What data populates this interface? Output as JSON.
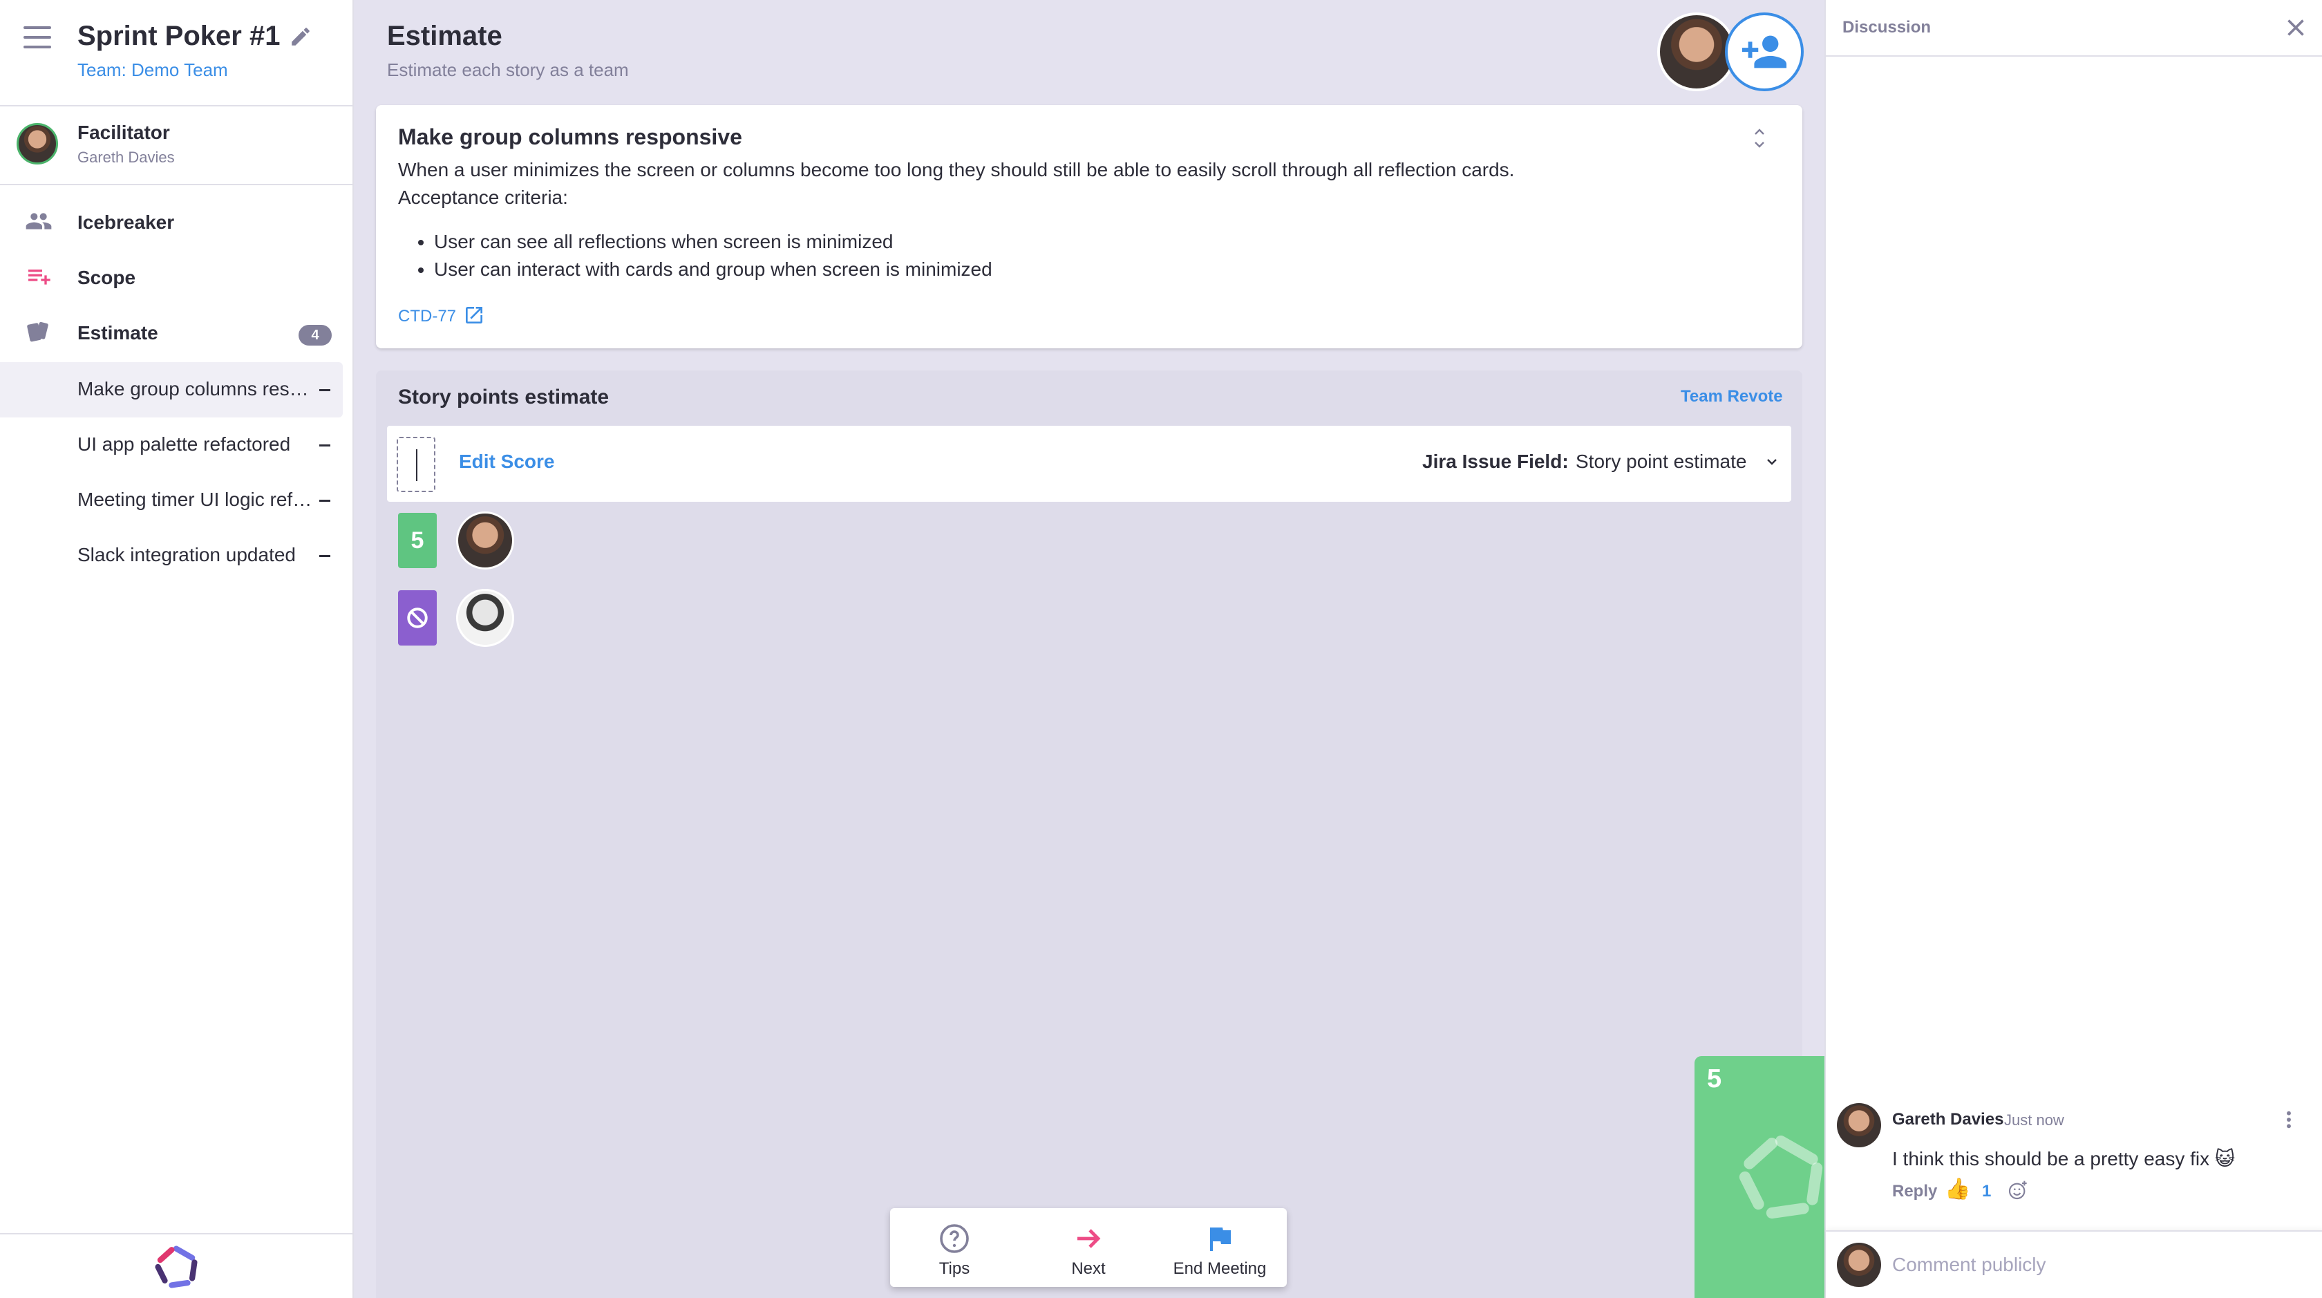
{
  "sidebar": {
    "meeting_title": "Sprint Poker #1",
    "team_link": "Team: Demo Team",
    "facilitator_label": "Facilitator",
    "facilitator_name": "Gareth Davies",
    "nav": [
      {
        "label": "Icebreaker",
        "icon": "group-icon"
      },
      {
        "label": "Scope",
        "icon": "playlist-add-icon"
      },
      {
        "label": "Estimate",
        "icon": "cards-icon",
        "badge": "4"
      }
    ],
    "stories": [
      {
        "label": "Make group columns responsive"
      },
      {
        "label": "UI app palette refactored"
      },
      {
        "label": "Meeting timer UI logic refactored"
      },
      {
        "label": "Slack integration updated"
      }
    ]
  },
  "header": {
    "title": "Estimate",
    "subtitle": "Estimate each story as a team"
  },
  "story": {
    "title": "Make group columns responsive",
    "description": "When a user minimizes the screen or columns become too long they should still be able to easily scroll through all reflection cards.",
    "criteria_label": "Acceptance criteria:",
    "bullets": [
      "User can see all reflections when screen is minimized",
      "User can interact with cards and group when screen is minimized"
    ],
    "issue_key": "CTD-77"
  },
  "estimate": {
    "heading": "Story points estimate",
    "team_revote": "Team Revote",
    "edit_score": "Edit Score",
    "jira_field_label": "Jira Issue Field:",
    "jira_field_value": "Story point estimate",
    "votes": [
      {
        "value": "5",
        "color": "#5fc581"
      },
      {
        "value": "pass",
        "color": "#8b5fcf"
      }
    ]
  },
  "bottom_bar": {
    "tips": "Tips",
    "next": "Next",
    "end_meeting": "End Meeting"
  },
  "floating_card": {
    "value": "5",
    "color": "#6fd08b"
  },
  "discussion": {
    "title": "Discussion",
    "comment": {
      "author": "Gareth Davies",
      "time": "Just now",
      "text": "I think this should be a pretty easy fix 😺",
      "reply": "Reply",
      "reaction_count": "1"
    },
    "input_placeholder": "Comment publicly"
  },
  "colors": {
    "accent": "#3b8ee6",
    "rose": "#ed4c86",
    "text": "#2d2d39",
    "muted": "#82809a"
  }
}
